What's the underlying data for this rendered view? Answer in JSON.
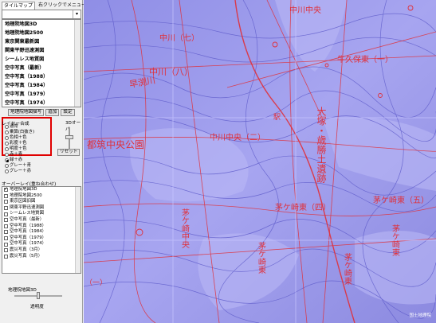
{
  "panel": {
    "tabs": [
      "タイルマップ",
      "右クリックでメニュー"
    ],
    "maps": [
      "地理院地図3D",
      "地理院地図2500",
      "東京関東最新図",
      "関東平野迅速測図",
      "シームレス地質図",
      "空中写真（最新）",
      "空中写真（1988）",
      "空中写真（1984）",
      "空中写真（1979）",
      "空中写真（1974）"
    ],
    "buttons": {
      "overlay": "地理院地図描写",
      "add": "追加",
      "settings": "設定",
      "reset": "リセット"
    },
    "layer": {
      "title": "レイヤー合成",
      "slider_label": "3Dオーバ",
      "options": [
        "通常",
        "乗算(白抜き)",
        "色相＋色",
        "彩度＋色",
        "明度＋色",
        "赤＋青",
        "緑＋赤",
        "グレー＋青",
        "グレー＋赤"
      ],
      "selected_index": 6
    },
    "overlay": {
      "title": "オーバーレイ(重ね合わせ)",
      "items": [
        "地理院地図3D",
        "地理院地図2500",
        "東京区図旧図",
        "関東平野迅速測図",
        "シームレス地質図",
        "空中写真（最新）",
        "空中写真（1988）",
        "空中写真（1984）",
        "空中写真（1979）",
        "空中写真（1974）",
        "震災写真（3月）",
        "震災写真（5月）"
      ],
      "checked_index": 0
    },
    "bottom_label": "地理院地図3D",
    "opacity_label": "透明度"
  },
  "map": {
    "labels": [
      "中川（七）",
      "中川（八）",
      "中川中央（二）",
      "中川中央",
      "牛久保東（一）",
      "早渕川",
      "大塚・歳勝土遺跡",
      "都筑中央公園",
      "茅ケ崎東（四）",
      "茅ケ崎東（五）",
      "茅ケ崎中央",
      "茅ケ崎東",
      "茅ケ崎東",
      "茅ケ崎東",
      "（一）",
      "駅"
    ],
    "credit": "国土地理院"
  }
}
